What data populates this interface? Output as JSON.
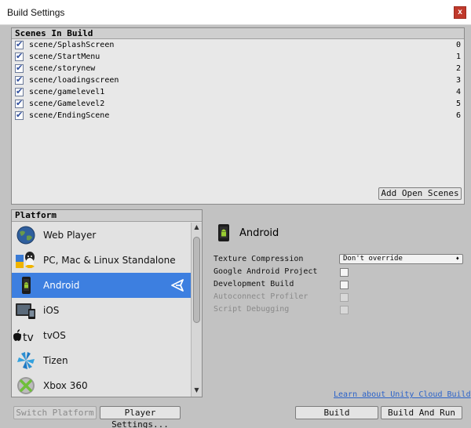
{
  "window": {
    "title": "Build Settings",
    "close_label": "x"
  },
  "scenes": {
    "header": "Scenes In Build",
    "items": [
      {
        "name": "scene/SplashScreen",
        "index": "0",
        "checked": true
      },
      {
        "name": "scene/StartMenu",
        "index": "1",
        "checked": true
      },
      {
        "name": "scene/storynew",
        "index": "2",
        "checked": true
      },
      {
        "name": "scene/loadingscreen",
        "index": "3",
        "checked": true
      },
      {
        "name": "scene/gamelevel1",
        "index": "4",
        "checked": true
      },
      {
        "name": "scene/Gamelevel2",
        "index": "5",
        "checked": true
      },
      {
        "name": "scene/EndingScene",
        "index": "6",
        "checked": true
      }
    ],
    "add_open_scenes_label": "Add Open Scenes"
  },
  "platform": {
    "header": "Platform",
    "items": [
      {
        "label": "Web Player",
        "icon": "web-player-globe-icon",
        "selected": false
      },
      {
        "label": "PC, Mac & Linux Standalone",
        "icon": "standalone-icon",
        "selected": false
      },
      {
        "label": "Android",
        "icon": "android-icon",
        "selected": true
      },
      {
        "label": "iOS",
        "icon": "ios-device-icon",
        "selected": false
      },
      {
        "label": "tvOS",
        "icon": "apple-tv-icon",
        "selected": false
      },
      {
        "label": "Tizen",
        "icon": "tizen-icon",
        "selected": false
      },
      {
        "label": "Xbox 360",
        "icon": "xbox-icon",
        "selected": false
      }
    ],
    "selected_platform_label": "Android"
  },
  "settings": {
    "texture_compression_label": "Texture Compression",
    "texture_compression_value": "Don't override",
    "google_android_project_label": "Google Android Project",
    "development_build_label": "Development Build",
    "autoconnect_profiler_label": "Autoconnect Profiler",
    "script_debugging_label": "Script Debugging"
  },
  "footer": {
    "cloud_build_link": "Learn about Unity Cloud Build",
    "switch_platform_label": "Switch Platform",
    "player_settings_label": "Player Settings...",
    "build_label": "Build",
    "build_and_run_label": "Build And Run"
  },
  "colors": {
    "selected_row": "#3d7fe0",
    "window_background": "#c2c2c2",
    "link": "#2a62c9",
    "close_button": "#c0392b"
  }
}
